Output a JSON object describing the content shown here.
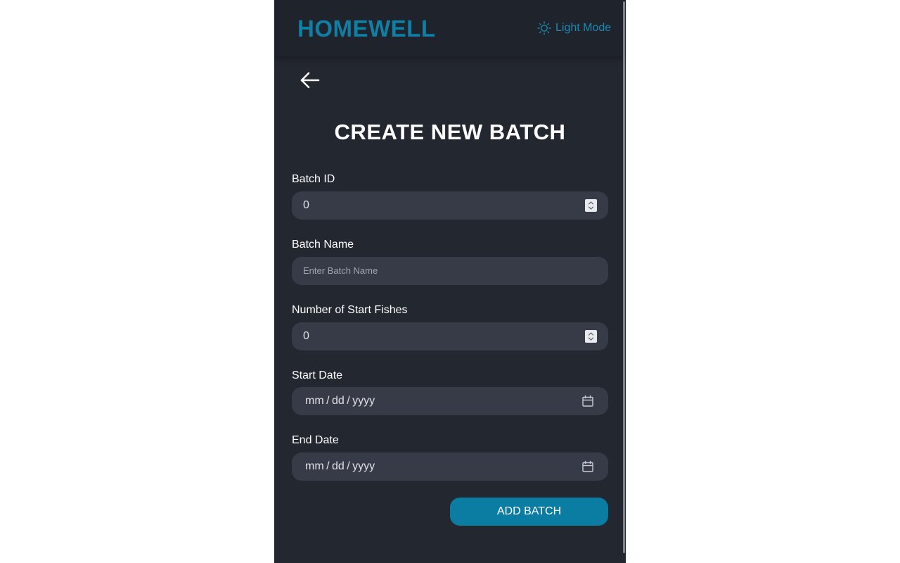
{
  "header": {
    "brand": "HOMEWELL",
    "mode_toggle_label": "Light Mode",
    "mode_toggle_icon": "sun-icon"
  },
  "navigation": {
    "back_icon": "arrow-left-icon"
  },
  "page": {
    "title": "CREATE NEW BATCH"
  },
  "form": {
    "batch_id": {
      "label": "Batch ID",
      "value": "0"
    },
    "batch_name": {
      "label": "Batch Name",
      "value": "",
      "placeholder": "Enter Batch Name"
    },
    "start_fishes": {
      "label": "Number of Start Fishes",
      "value": "0"
    },
    "start_date": {
      "label": "Start Date",
      "value": "mm / dd / yyyy",
      "icon": "calendar-icon"
    },
    "end_date": {
      "label": "End Date",
      "value": "mm / dd / yyyy",
      "icon": "calendar-icon"
    },
    "submit_label": "ADD BATCH"
  },
  "colors": {
    "accent": "#0b7da3",
    "brand": "#0f7fa6",
    "panel_background": "#232730",
    "header_background": "#1f232b",
    "input_background": "#373b48"
  }
}
